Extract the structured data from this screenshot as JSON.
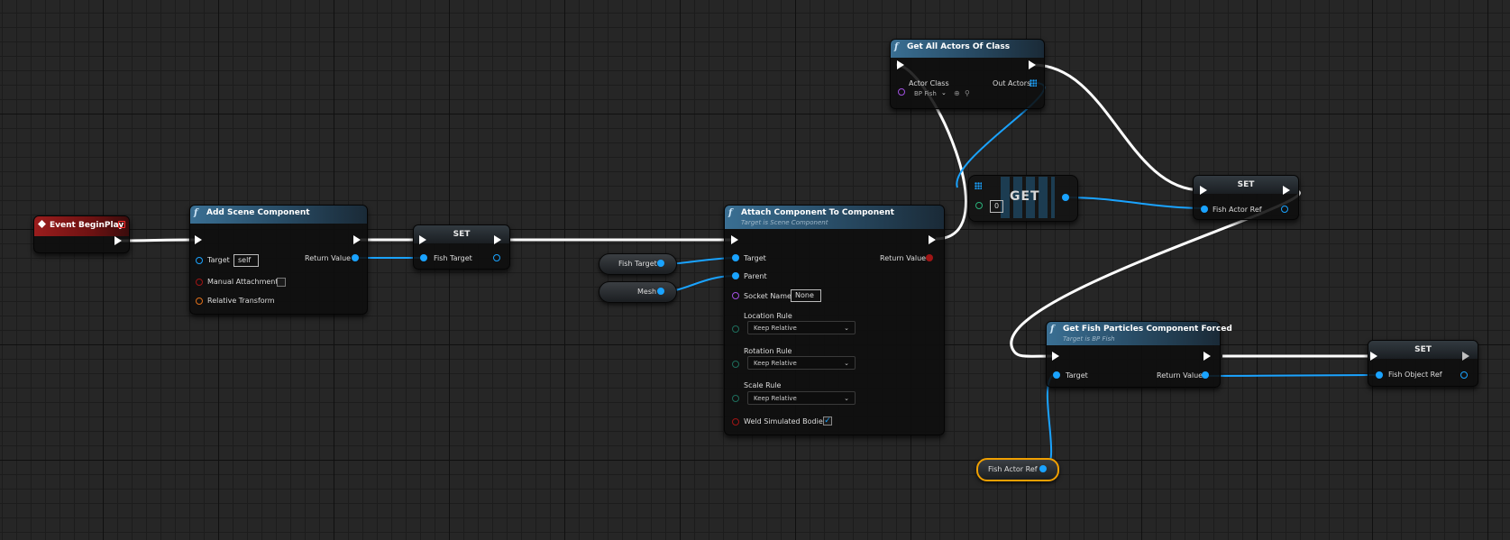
{
  "graph": {
    "event_begin_play": {
      "title": "Event BeginPlay"
    },
    "add_scene_component": {
      "title": "Add Scene Component",
      "target_label": "Target",
      "target_value": "self",
      "return_label": "Return Value",
      "manual_attachment_label": "Manual Attachment",
      "relative_transform_label": "Relative Transform"
    },
    "set_fish_target": {
      "title": "SET",
      "pin_label": "Fish Target"
    },
    "var_fish_target": {
      "label": "Fish Target"
    },
    "var_mesh": {
      "label": "Mesh"
    },
    "attach_component": {
      "title": "Attach Component To Component",
      "subtitle": "Target is Scene Component",
      "target_label": "Target",
      "parent_label": "Parent",
      "return_label": "Return Value",
      "socket_name_label": "Socket Name",
      "socket_name_value": "None",
      "location_rule_label": "Location Rule",
      "location_rule_value": "Keep Relative",
      "rotation_rule_label": "Rotation Rule",
      "rotation_rule_value": "Keep Relative",
      "scale_rule_label": "Scale Rule",
      "scale_rule_value": "Keep Relative",
      "weld_label": "Weld Simulated Bodies",
      "weld_checked": true
    },
    "get_all_actors": {
      "title": "Get All Actors Of Class",
      "actor_class_label": "Actor Class",
      "actor_class_value": "BP Fish",
      "out_actors_label": "Out Actors"
    },
    "get_array": {
      "title": "GET",
      "index_value": "0"
    },
    "set_fish_actor_ref": {
      "title": "SET",
      "pin_label": "Fish Actor Ref"
    },
    "get_particles": {
      "title": "Get Fish Particles Component Forced",
      "subtitle": "Target is BP Fish",
      "target_label": "Target",
      "return_label": "Return Value"
    },
    "set_fish_object_ref": {
      "title": "SET",
      "pin_label": "Fish Object Ref"
    },
    "var_fish_actor_ref": {
      "label": "Fish Actor Ref"
    }
  },
  "colors": {
    "exec_wire": "#ffffff",
    "object_wire": "#1aa3ff",
    "event_header": "#9a1d1d",
    "function_header": "#3a6f93",
    "selection": "#f0a000"
  },
  "icons": [
    "function-icon",
    "event-icon",
    "exec-pin-icon",
    "object-pin-icon",
    "array-pin-icon",
    "chevron-down-icon",
    "checkmark-icon",
    "search-icon",
    "browse-icon"
  ]
}
